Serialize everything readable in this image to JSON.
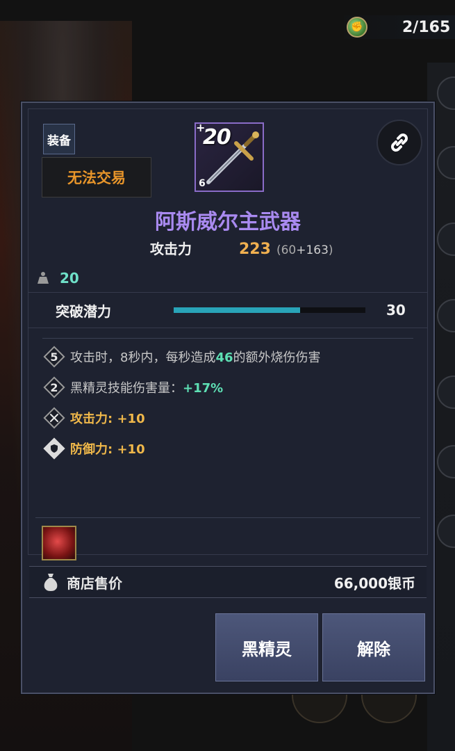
{
  "top_bar": {
    "icon": "fist-token-icon",
    "count": "2/165"
  },
  "item": {
    "category_tag": "装备",
    "trade_tag": "无法交易",
    "enhance_prefix": "+",
    "enhance_level": "20",
    "lock_count": "6",
    "icon": "sword-icon",
    "name": "阿斯威尔主武器",
    "attack_label": "攻击力",
    "attack_value": "223",
    "attack_base": "(60",
    "attack_plus": "+163",
    "attack_close": ")",
    "weight": "20",
    "breakthrough_label": "突破潜力",
    "breakthrough_value": "30",
    "breakthrough_ratio": 0.66
  },
  "stats": [
    {
      "badge": "5",
      "text_a": "攻击时，8秒内，每秒造成",
      "highlight": "46",
      "text_b": "的额外烧伤伤害"
    },
    {
      "badge": "2",
      "text_a": "黑精灵技能伤害量：",
      "highlight": "+17%"
    },
    {
      "badge_icon": "crossed-swords-icon",
      "text": "攻击力: +10"
    },
    {
      "badge_icon": "shield-icon",
      "text": "防御力: +10"
    }
  ],
  "gem": {
    "icon": "red-crystal-icon"
  },
  "shop": {
    "label": "商店售价",
    "price": "66,000银币"
  },
  "buttons": {
    "black_spirit": "黑精灵",
    "release": "解除"
  },
  "colors": {
    "item_name": "#a98af0",
    "trade_tag": "#e8952a",
    "attack_value": "#f0b050",
    "highlight": "#5ee0b4",
    "bar_fill": "#29a4b8"
  }
}
